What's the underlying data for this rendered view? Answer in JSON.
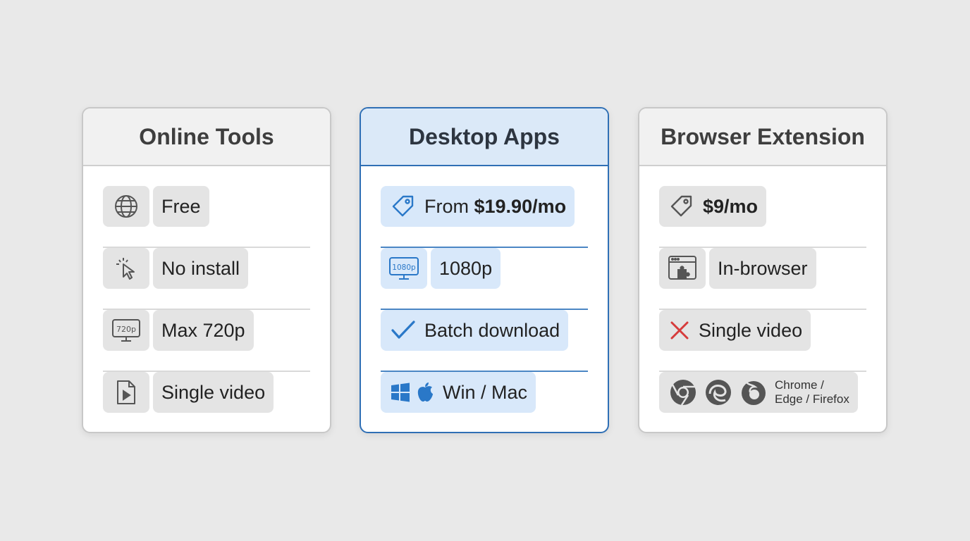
{
  "cards": [
    {
      "title": "Online Tools",
      "rows": [
        {
          "icon": "globe-icon",
          "label": "Free"
        },
        {
          "icon": "cursor-click-icon",
          "label": "No install"
        },
        {
          "icon": "monitor-720p-icon",
          "icon_text": "720p",
          "label": "Max 720p"
        },
        {
          "icon": "video-file-icon",
          "label": "Single video"
        }
      ]
    },
    {
      "title": "Desktop Apps",
      "rows": [
        {
          "icon": "price-tag-icon",
          "label_prefix": "From ",
          "label_bold": "$19.90/mo"
        },
        {
          "icon": "monitor-1080p-icon",
          "icon_text": "1080p",
          "label": "1080p"
        },
        {
          "icon": "checkmark-icon",
          "label": "Batch download"
        },
        {
          "icon": "windows-apple-icon",
          "label": "Win / Mac"
        }
      ]
    },
    {
      "title": "Browser Extension",
      "rows": [
        {
          "icon": "price-tag-icon",
          "label_bold": "$9/mo"
        },
        {
          "icon": "browser-extension-icon",
          "label": "In-browser"
        },
        {
          "icon": "x-mark-icon",
          "label": "Single video"
        },
        {
          "icon": "chrome-edge-firefox-icons",
          "label_line1": "Chrome /",
          "label_line2": "Edge / Firefox"
        }
      ]
    }
  ],
  "colors": {
    "accent": "#2f6fb5",
    "accent_fill": "#d8e8fa",
    "x_mark": "#d63b3b"
  }
}
